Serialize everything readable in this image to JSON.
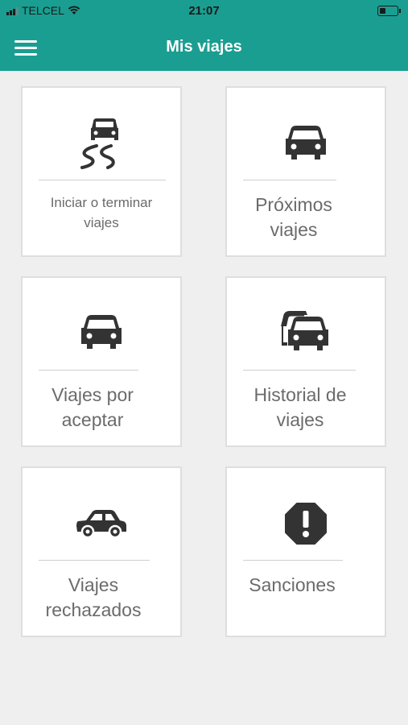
{
  "status_bar": {
    "carrier": "TELCEL",
    "time": "21:07",
    "battery_level": 0.35
  },
  "nav": {
    "title": "Mis viajes",
    "menu_icon": "hamburger-menu-icon"
  },
  "colors": {
    "primary": "#1a9e91",
    "background": "#efefef",
    "card": "#ffffff",
    "icon": "#333333",
    "label": "#6b6b6b"
  },
  "tiles": [
    {
      "icon": "car-skidding-icon",
      "line1": "Iniciar o terminar",
      "line2": "viajes"
    },
    {
      "icon": "car-front-icon",
      "line1": "Próximos",
      "line2": "viajes"
    },
    {
      "icon": "car-front-icon",
      "line1": "Viajes por",
      "line2": "aceptar"
    },
    {
      "icon": "cars-history-icon",
      "line1": "Historial de",
      "line2": "viajes"
    },
    {
      "icon": "car-side-icon",
      "line1": "Viajes",
      "line2": "rechazados"
    },
    {
      "icon": "alert-octagon-icon",
      "line1": "Sanciones",
      "line2": ""
    }
  ]
}
